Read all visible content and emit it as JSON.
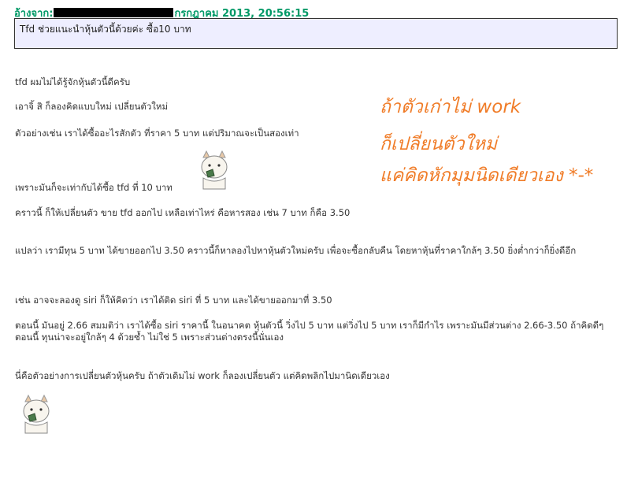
{
  "quote": {
    "prefix": "อ้างจาก:",
    "date_suffix": "กรกฎาคม 2013, 20:56:15",
    "text": "Tfd ช่วยแนะนำหุ้นตัวนี้ด้วยค่ะ  ซื้อ10 บาท"
  },
  "post": {
    "lines": [
      "tfd ผมไม่ได้รู้จักหุ้นตัวนี้ดีครับ",
      "เอาจิ้ สิ ก็ลองคิดแบบใหม่ เปลี่ยนตัวใหม่",
      "ตัวอย่างเช่น เราได้ซื้ออะไรสักตัว ที่ราคา 5 บาท แต่ปริมาณจะเป็นสองเท่า",
      "เพราะมันก็จะเท่ากับได้ซื้อ tfd ที่ 10 บาท",
      "คราวนี้ ก็ให้เปลี่ยนตัว ขาย tfd ออกไป เหลือเท่าไหร่ คือหารสอง เช่น 7 บาท ก็คือ 3.50",
      "แปลว่า เรามีทุน 5 บาท ได้ขายออกไป 3.50 คราวนี้ก็หาลองไปหาหุ้นตัวใหม่ครับ เพื่อจะซื้อกลับคืน โดยหาหุ้นที่ราคาใกล้ๆ 3.50 ยิ่งต่ำกว่าก็ยิ่งดีอีก",
      "เช่น อาจจะลองดู siri ก็ให้คิดว่า เราได้ติด siri ที่ 5 บาท และได้ขายออกมาที่ 3.50",
      "ตอนนี้ มันอยู่ 2.66 สมมติว่า เราได้ซื้อ siri ราคานี้ ในอนาคต หุ้นตัวนี้ วิ่งไป 5 บาท แต่วิ่งไป 5 บาท เราก็มีกำไร เพราะมันมีส่วนต่าง 2.66-3.50 ถ้าคิดดีๆ ตอนนี้ ทุนน่าจะอยู่ใกล้ๆ 4 ด้วยซ้ำ ไม่ใช่ 5 เพราะส่วนต่างตรงนี้นั่นเอง",
      "นี่คือตัวอย่างการเปลี่ยนตัวหุ้นครับ ถ้าตัวเดิมไม่ work ก็ลองเปลี่ยนตัว แต่คิดพลิกไปมานิดเดียวเอง"
    ]
  },
  "overlay": {
    "line1": "ถ้าตัวเก่าไม่ work",
    "line2": "ก็เปลี่ยนตัวใหม่",
    "line3": "แค่คิดหักมุมนิดเดียวเอง *-*",
    "color": "#f07c28"
  },
  "colors": {
    "quote_header": "#009966",
    "quote_bg": "#eeeeff"
  },
  "icons": [
    "emoticon-thinking-icon",
    "emoticon-thinking-icon"
  ]
}
